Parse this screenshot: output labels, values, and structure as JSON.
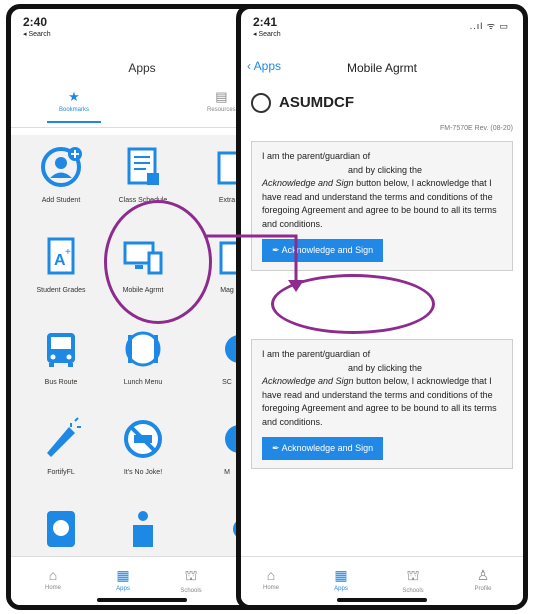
{
  "left": {
    "time": "2:40",
    "back_app": "◂ Search",
    "header": "Apps",
    "tabs": [
      {
        "label": "Bookmarks",
        "icon": "star-icon"
      },
      {
        "label": "Resources",
        "icon": "folder-icon"
      }
    ],
    "apps": [
      {
        "label": "Add Student"
      },
      {
        "label": "Class Schedule"
      },
      {
        "label": "Extra"
      },
      {
        "label": "Student Grades"
      },
      {
        "label": "Mobile Agrmt"
      },
      {
        "label": "Mag"
      },
      {
        "label": "Bus Route"
      },
      {
        "label": "Lunch Menu"
      },
      {
        "label": "SC"
      },
      {
        "label": "FortifyFL"
      },
      {
        "label": "It's No Joke!"
      },
      {
        "label": "M"
      },
      {
        "label": ""
      },
      {
        "label": ""
      },
      {
        "label": ""
      }
    ],
    "nav": [
      {
        "label": "Home",
        "icon": "home-icon"
      },
      {
        "label": "Apps",
        "icon": "grid-icon"
      },
      {
        "label": "Schools",
        "icon": "school-icon"
      }
    ]
  },
  "right": {
    "time": "2:41",
    "back_app": "◂ Search",
    "signal": "..ıl ᯤ ▭",
    "back_label": "Apps",
    "title": "Mobile Agrmt",
    "org": "ASUMDCF",
    "form_id": "FM-7570E Rev. (08-20)",
    "cards": [
      {
        "line1": "I am the parent/guardian of",
        "line2": "and by clicking the",
        "italic": "Acknowledge and Sign",
        "rest": " button below, I acknowledge that I have read and understand the terms and conditions of the foregoing Agreement and agree to be bound to all its terms and conditions.",
        "button": "Acknowledge and Sign"
      },
      {
        "line1": "I am the parent/guardian of",
        "line2": "and by clicking the",
        "italic": "Acknowledge and Sign",
        "rest": " button below, I acknowledge that I have read and understand the terms and conditions of the foregoing Agreement and agree to be bound to all its terms and conditions.",
        "button": "Acknowledge and Sign"
      }
    ],
    "nav": [
      {
        "label": "Home",
        "icon": "home-icon"
      },
      {
        "label": "Apps",
        "icon": "grid-icon"
      },
      {
        "label": "Schools",
        "icon": "school-icon"
      },
      {
        "label": "Profile",
        "icon": "person-icon"
      }
    ]
  },
  "colors": {
    "accent": "#1e88e5",
    "annotation": "#8e2b8e"
  }
}
